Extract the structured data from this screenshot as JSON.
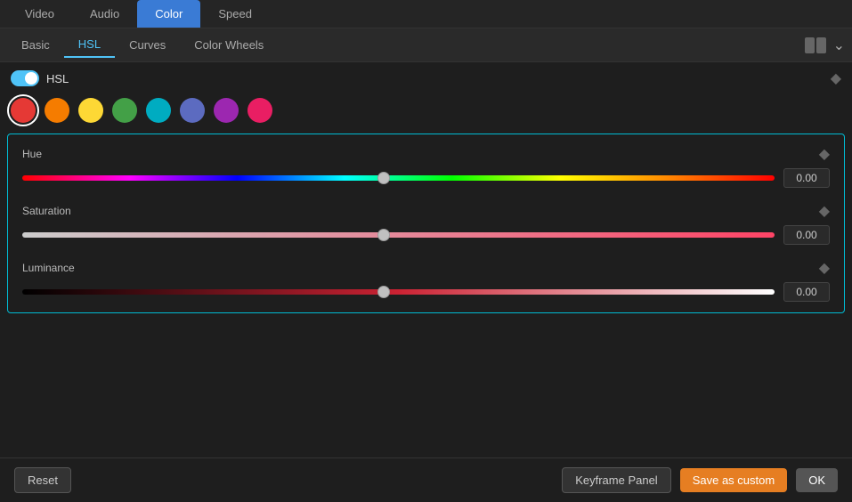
{
  "top_tabs": {
    "tabs": [
      {
        "label": "Video",
        "active": false
      },
      {
        "label": "Audio",
        "active": false
      },
      {
        "label": "Color",
        "active": true
      },
      {
        "label": "Speed",
        "active": false
      }
    ]
  },
  "sub_tabs": {
    "tabs": [
      {
        "label": "Basic",
        "active": false
      },
      {
        "label": "HSL",
        "active": true
      },
      {
        "label": "Curves",
        "active": false
      },
      {
        "label": "Color Wheels",
        "active": false
      }
    ]
  },
  "hsl_panel": {
    "label": "HSL",
    "toggle_on": true
  },
  "color_circles": [
    {
      "color": "#e53935",
      "selected": true,
      "name": "red"
    },
    {
      "color": "#f57c00",
      "selected": false,
      "name": "orange"
    },
    {
      "color": "#fdd835",
      "selected": false,
      "name": "yellow"
    },
    {
      "color": "#43a047",
      "selected": false,
      "name": "green"
    },
    {
      "color": "#00acc1",
      "selected": false,
      "name": "cyan"
    },
    {
      "color": "#5c6bc0",
      "selected": false,
      "name": "blue"
    },
    {
      "color": "#9c27b0",
      "selected": false,
      "name": "purple"
    },
    {
      "color": "#e91e63",
      "selected": false,
      "name": "pink"
    }
  ],
  "sliders": [
    {
      "label": "Hue",
      "value": "0.00",
      "position_pct": 48,
      "track_type": "hue"
    },
    {
      "label": "Saturation",
      "value": "0.00",
      "position_pct": 48,
      "track_type": "saturation"
    },
    {
      "label": "Luminance",
      "value": "0.00",
      "position_pct": 48,
      "track_type": "luminance"
    }
  ],
  "bottom_bar": {
    "reset_label": "Reset",
    "keyframe_label": "Keyframe Panel",
    "save_custom_label": "Save as custom",
    "ok_label": "OK"
  }
}
